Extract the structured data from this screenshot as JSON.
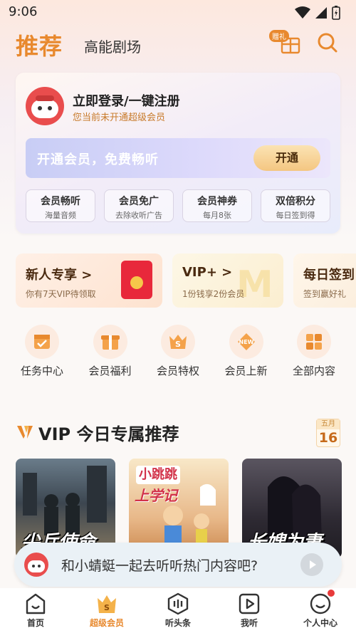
{
  "status_bar": {
    "time": "9:06"
  },
  "header": {
    "tab_recommend": "推荐",
    "tab_theater": "高能剧场",
    "gift_label": "赠礼"
  },
  "member_card": {
    "login_title": "立即登录/一键注册",
    "login_sub": "您当前未开通超级会员",
    "open_text": "开通会员，免费畅听",
    "open_button": "开通",
    "perks": [
      {
        "title": "会员畅听",
        "sub": "海量音频"
      },
      {
        "title": "会员免广",
        "sub": "去除收听广告"
      },
      {
        "title": "会员神券",
        "sub": "每月8张"
      },
      {
        "title": "双倍积分",
        "sub": "每日签到得"
      }
    ]
  },
  "promos": [
    {
      "title": "新人专享 >",
      "sub": "你有7天VIP待领取"
    },
    {
      "title": "VIP+ >",
      "sub": "1份钱享2份会员"
    },
    {
      "title": "每日签到",
      "sub": "签到赢好礼"
    }
  ],
  "quick_items": [
    {
      "label": "任务中心",
      "icon": "calendar-check-icon"
    },
    {
      "label": "会员福利",
      "icon": "gift-icon"
    },
    {
      "label": "会员特权",
      "icon": "vip-crown-icon"
    },
    {
      "label": "会员上新",
      "icon": "new-badge-icon"
    },
    {
      "label": "全部内容",
      "icon": "grid-icon"
    }
  ],
  "section": {
    "title": "VIP 今日专属推荐",
    "date_month": "五月",
    "date_day": "16"
  },
  "covers": [
    {
      "title": "尖兵使命"
    },
    {
      "title": "上学记",
      "badge": "小跳跳"
    },
    {
      "title": "长嫂为妻"
    }
  ],
  "prompt": {
    "text": "和小蜻蜓一起去听听热门内容吧?"
  },
  "bottom_nav": [
    {
      "label": "首页",
      "icon": "home-icon"
    },
    {
      "label": "超级会员",
      "icon": "vip-icon"
    },
    {
      "label": "听头条",
      "icon": "headline-icon"
    },
    {
      "label": "我听",
      "icon": "play-icon"
    },
    {
      "label": "个人中心",
      "icon": "profile-icon"
    }
  ],
  "colors": {
    "accent": "#e8892e",
    "red": "#e94d4d",
    "text": "#222222"
  }
}
